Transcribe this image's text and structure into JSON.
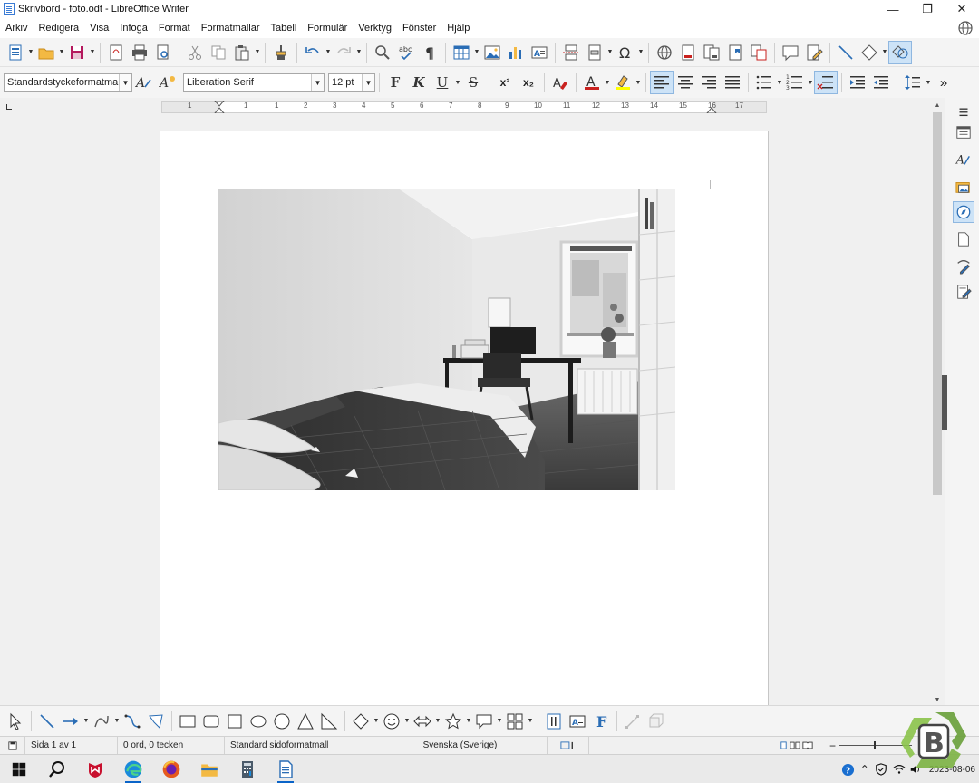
{
  "window": {
    "title": "Skrivbord - foto.odt - LibreOffice Writer"
  },
  "menu": [
    "Arkiv",
    "Redigera",
    "Visa",
    "Infoga",
    "Format",
    "Formatmallar",
    "Tabell",
    "Formulär",
    "Verktyg",
    "Fönster",
    "Hjälp"
  ],
  "format_bar": {
    "paragraph_style": "Standardstyckeformatmall",
    "font_name": "Liberation Serif",
    "font_size": "12 pt",
    "bold_label": "F",
    "italic_label": "K",
    "underline_label": "U",
    "strike_label": "S",
    "superscript_label": "x²",
    "subscript_label": "x₂"
  },
  "ruler": {
    "labels": [
      "1",
      "1",
      "1",
      "2",
      "3",
      "4",
      "5",
      "6",
      "7",
      "8",
      "9",
      "10",
      "11",
      "12",
      "13",
      "14",
      "15",
      "16",
      "17",
      "18"
    ]
  },
  "document": {
    "image_alt": "bedroom photo"
  },
  "status": {
    "page": "Sida 1 av 1",
    "words": "0 ord, 0 tecken",
    "page_style": "Standard sidoformatmall",
    "language": "Svenska (Sverige)"
  },
  "taskbar": {
    "date": "2023-08-06"
  },
  "colors": {
    "accent": "#0a64c8",
    "font_color": "#c9211e",
    "highlight": "#ffff00",
    "active_button": "#cde3f7"
  }
}
